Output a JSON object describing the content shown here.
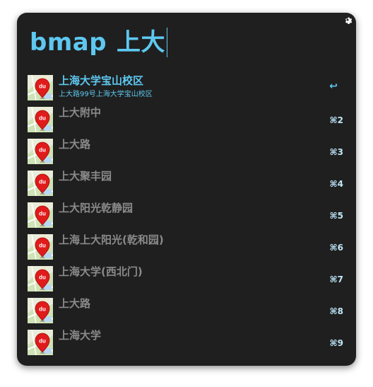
{
  "query": {
    "keyword": "bmap",
    "text": "上大"
  },
  "colors": {
    "accent": "#5ec8f0",
    "background": "#1f1f1f",
    "muted_text": "#8a8a8a"
  },
  "settings_icon": "gear-icon",
  "results": [
    {
      "title": "上海大学宝山校区",
      "subtitle": "上大路99号上海大学宝山校区",
      "shortcut": "↩",
      "icon": "baidu-maps-icon"
    },
    {
      "title": "上大附中",
      "shortcut": "⌘2",
      "icon": "baidu-maps-icon"
    },
    {
      "title": "上大路",
      "shortcut": "⌘3",
      "icon": "baidu-maps-icon"
    },
    {
      "title": "上大聚丰园",
      "shortcut": "⌘4",
      "icon": "baidu-maps-icon"
    },
    {
      "title": "上大阳光乾静园",
      "shortcut": "⌘5",
      "icon": "baidu-maps-icon"
    },
    {
      "title": "上海上大阳光(乾和园)",
      "shortcut": "⌘6",
      "icon": "baidu-maps-icon"
    },
    {
      "title": "上海大学(西北门)",
      "shortcut": "⌘7",
      "icon": "baidu-maps-icon"
    },
    {
      "title": "上大路",
      "shortcut": "⌘8",
      "icon": "baidu-maps-icon"
    },
    {
      "title": "上海大学",
      "shortcut": "⌘9",
      "icon": "baidu-maps-icon"
    }
  ]
}
